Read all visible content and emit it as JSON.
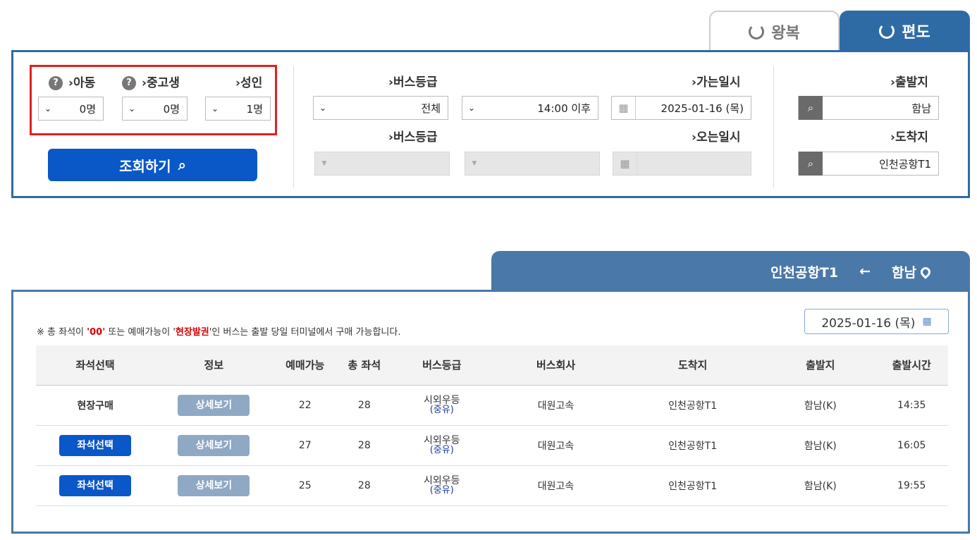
{
  "tabs": {
    "oneway_label": "편도",
    "round_label": "왕복"
  },
  "search_form": {
    "departure": {
      "label": "출발지",
      "value": "함남"
    },
    "arrival": {
      "label": "도착지",
      "value": "인천공항T1"
    },
    "depart_datetime": {
      "label": "가는일시",
      "date_value": "2025-01-16 (목)",
      "time_value": "14:00 이후"
    },
    "return_datetime": {
      "label": "오는일시"
    },
    "depart_grade": {
      "label": "버스등급",
      "value": "전체"
    },
    "return_grade": {
      "label": "버스등급"
    },
    "passengers": {
      "adult": {
        "label": "성인",
        "value": "1명"
      },
      "teen": {
        "label": "중고생",
        "value": "0명"
      },
      "child": {
        "label": "아동",
        "value": "0명"
      }
    },
    "search_button": "조회하기"
  },
  "route": {
    "from": "함남",
    "to": "인천공항T1"
  },
  "results": {
    "date": "2025-01-16 (목)",
    "notice_prefix": "※ 총 좌석이 ",
    "notice_zero": "'00'",
    "notice_mid": " 또는 예매가능이 '",
    "notice_red": "현장발권",
    "notice_suffix": "'인 버스는 출발 당일 터미널에서 구매 가능합니다.",
    "columns": [
      "출발시간",
      "출발지",
      "도착지",
      "버스회사",
      "버스등급",
      "총 좌석",
      "예매가능",
      "정보",
      "좌석선택"
    ],
    "rows": [
      {
        "time": "14:35",
        "from": "함남(K)",
        "to": "인천공항T1",
        "company": "대원고속",
        "grade": "시외우등",
        "grade_sub": "(중유)",
        "total": "28",
        "available": "22",
        "info": "상세보기",
        "select": "현장구매",
        "select_type": "onsite"
      },
      {
        "time": "16:05",
        "from": "함남(K)",
        "to": "인천공항T1",
        "company": "대원고속",
        "grade": "시외우등",
        "grade_sub": "(중유)",
        "total": "28",
        "available": "27",
        "info": "상세보기",
        "select": "좌석선택",
        "select_type": "button"
      },
      {
        "time": "19:55",
        "from": "함남(K)",
        "to": "인천공항T1",
        "company": "대원고속",
        "grade": "시외우등",
        "grade_sub": "(중유)",
        "total": "28",
        "available": "25",
        "info": "상세보기",
        "select": "좌석선택",
        "select_type": "button"
      }
    ]
  }
}
